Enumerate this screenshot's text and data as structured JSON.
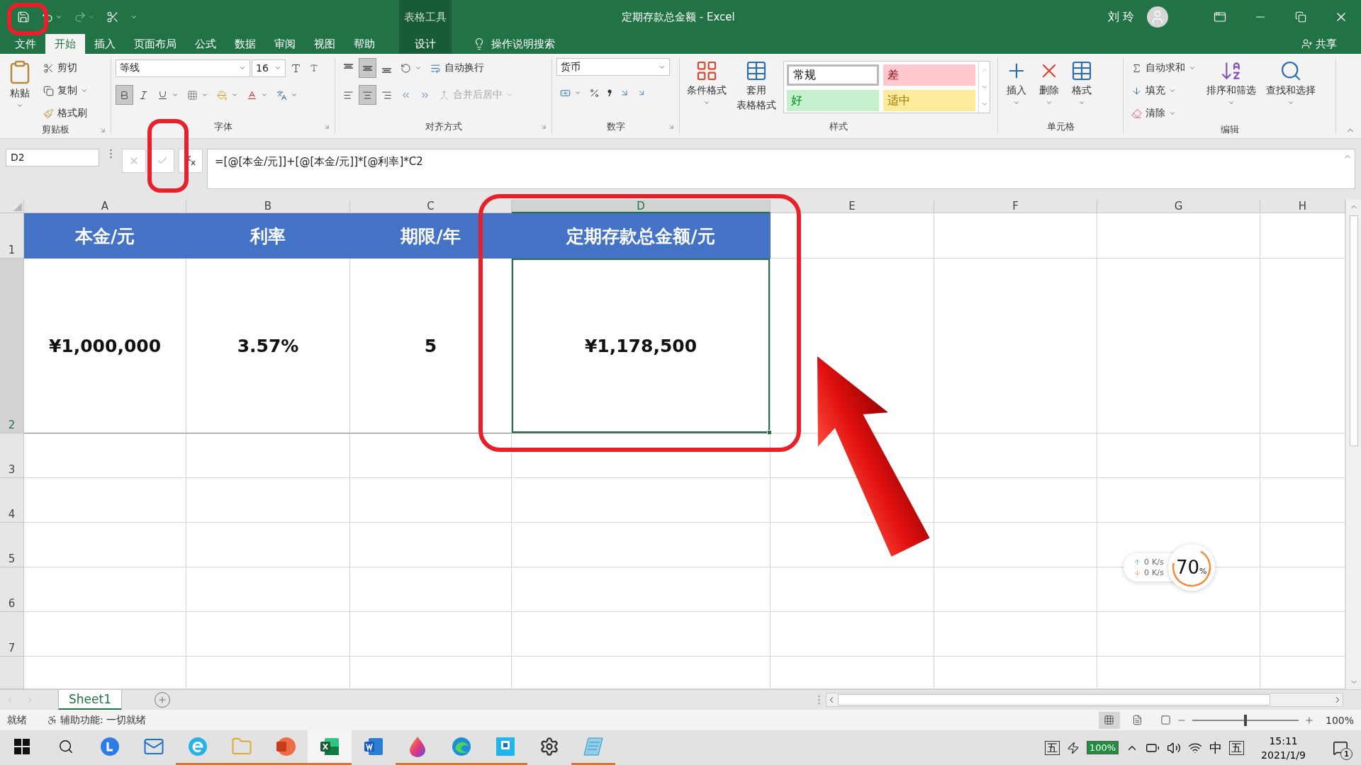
{
  "title_bar": {
    "context_label": "表格工具",
    "title": "定期存款总金额  -  Excel",
    "user": "刘 玲"
  },
  "ribbon_tabs": [
    {
      "label": "文件",
      "selected": false,
      "kind": "normal"
    },
    {
      "label": "开始",
      "selected": true,
      "kind": "normal"
    },
    {
      "label": "插入",
      "selected": false,
      "kind": "normal"
    },
    {
      "label": "页面布局",
      "selected": false,
      "kind": "normal"
    },
    {
      "label": "公式",
      "selected": false,
      "kind": "normal"
    },
    {
      "label": "数据",
      "selected": false,
      "kind": "normal"
    },
    {
      "label": "审阅",
      "selected": false,
      "kind": "normal"
    },
    {
      "label": "视图",
      "selected": false,
      "kind": "normal"
    },
    {
      "label": "帮助",
      "selected": false,
      "kind": "normal"
    },
    {
      "label": "设计",
      "selected": false,
      "kind": "contextual"
    }
  ],
  "tell_me": "操作说明搜索",
  "share": "共享",
  "clipboard": {
    "paste": "粘贴",
    "cut": "剪切",
    "copy": "复制",
    "format_painter": "格式刷",
    "group": "剪贴板"
  },
  "font": {
    "name": "等线",
    "size": "16",
    "bold": true,
    "italic": false,
    "underline": false,
    "group": "字体"
  },
  "alignment": {
    "wrap": "自动换行",
    "merge": "合并后居中",
    "merge_disabled": true,
    "vertical": [
      {
        "kind": "top",
        "selected": false
      },
      {
        "kind": "middle",
        "selected": true
      },
      {
        "kind": "bottom",
        "selected": false
      }
    ],
    "horizontal": [
      {
        "kind": "left",
        "selected": false
      },
      {
        "kind": "center",
        "selected": true
      },
      {
        "kind": "right",
        "selected": false
      }
    ],
    "group": "对齐方式"
  },
  "number": {
    "format": "货币",
    "group": "数字"
  },
  "styles": {
    "conditional": "条件格式",
    "table_format_lines": [
      "套用",
      "表格格式"
    ],
    "gallery": [
      {
        "label": "常规",
        "color": "#ffffff",
        "selected": true
      },
      {
        "label": "差",
        "color": "#ffc7ce",
        "selected": false
      },
      {
        "label": "好",
        "color": "#c6efce",
        "selected": false
      },
      {
        "label": "适中",
        "color": "#ffeb9c",
        "selected": false
      }
    ],
    "group": "样式"
  },
  "cells": {
    "buttons": [
      {
        "label": "插入",
        "kind": "insert"
      },
      {
        "label": "删除",
        "kind": "delete"
      },
      {
        "label": "格式",
        "kind": "format"
      }
    ],
    "group": "单元格"
  },
  "editing": {
    "autosum": "自动求和",
    "fill": "填充",
    "clear": "清除",
    "sort": "排序和筛选",
    "find": "查找和选择",
    "group": "编辑"
  },
  "formula_bar": {
    "name_box": "D2",
    "formula": "=[@[本金/元]]+[@[本金/元]]*[@利率]*C2"
  },
  "sheet": {
    "columns": [
      {
        "label": "A",
        "selected": false
      },
      {
        "label": "B",
        "selected": false
      },
      {
        "label": "C",
        "selected": false
      },
      {
        "label": "D",
        "selected": true
      },
      {
        "label": "E",
        "selected": false
      },
      {
        "label": "F",
        "selected": false
      },
      {
        "label": "G",
        "selected": false
      },
      {
        "label": "H",
        "selected": false
      }
    ],
    "rows": [
      {
        "label": "1",
        "selected": false
      },
      {
        "label": "2",
        "selected": true
      },
      {
        "label": "3",
        "selected": false
      },
      {
        "label": "4",
        "selected": false
      },
      {
        "label": "5",
        "selected": false
      },
      {
        "label": "6",
        "selected": false
      },
      {
        "label": "7",
        "selected": false
      }
    ],
    "header_cells": [
      "本金/元",
      "利率",
      "期限/年",
      "定期存款总金额/元"
    ],
    "data_cells": [
      {
        "text": "¥1,000,000",
        "selected": false
      },
      {
        "text": "3.57%",
        "selected": false
      },
      {
        "text": "5",
        "selected": false
      },
      {
        "text": "¥1,178,500",
        "selected": true
      }
    ]
  },
  "sheet_tabs": [
    {
      "label": "Sheet1",
      "selected": true
    }
  ],
  "status_bar": {
    "ready": "就绪",
    "accessibility": "辅助功能: 一切就绪",
    "zoom": "100%",
    "zoom_slider": {
      "level": 0.5
    }
  },
  "net_widget": {
    "upload": "0",
    "upload_unit": "K/s",
    "download": "0",
    "download_unit": "K/s",
    "memory": "70",
    "memory_unit": "%"
  },
  "taskbar": {
    "apps": [
      {
        "kind": "assistant",
        "running": false,
        "selected": false
      },
      {
        "kind": "mail",
        "running": false,
        "selected": false
      },
      {
        "kind": "browser",
        "running": true,
        "selected": false
      },
      {
        "kind": "explorer",
        "running": true,
        "selected": false
      },
      {
        "kind": "powerpoint",
        "running": true,
        "selected": false
      },
      {
        "kind": "excel",
        "running": true,
        "selected": true
      },
      {
        "kind": "word",
        "running": false,
        "selected": false
      },
      {
        "kind": "paint",
        "running": true,
        "selected": false
      },
      {
        "kind": "edge",
        "running": true,
        "selected": false
      },
      {
        "kind": "tool",
        "running": true,
        "selected": false
      },
      {
        "kind": "settings",
        "running": false,
        "selected": false
      },
      {
        "kind": "notepad",
        "running": true,
        "selected": false
      }
    ],
    "tray": {
      "ime_left": "五",
      "battery": "100%",
      "language": "中",
      "ime_right": "五",
      "time": "15:11",
      "date": "2021/1/9",
      "notifications": "1"
    }
  }
}
